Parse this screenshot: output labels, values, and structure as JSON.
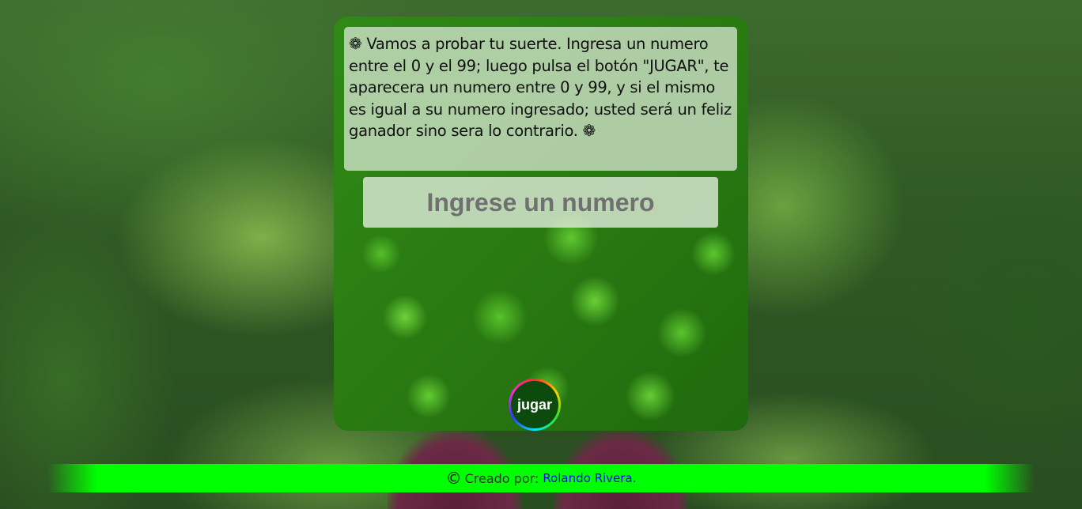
{
  "intro": {
    "flower_icon": "❁",
    "text": "Vamos a probar tu suerte. Ingresa un numero entre el 0 y el 99; luego pulsa el botón \"JUGAR\", te aparecera un numero entre 0 y 99, y si el mismo es igual a su numero ingresado; usted será un feliz ganador sino sera lo contrario."
  },
  "number_input": {
    "placeholder": "Ingrese un numero",
    "value": ""
  },
  "play_button": {
    "label": "jugar"
  },
  "footer": {
    "copyright_symbol": "©",
    "created_by": "Creado por:",
    "author": "Rolando Rivera."
  },
  "colors": {
    "footer_bar": "#00ff00",
    "author_link": "#0000ee",
    "button_fill": "#0d4a0d"
  }
}
